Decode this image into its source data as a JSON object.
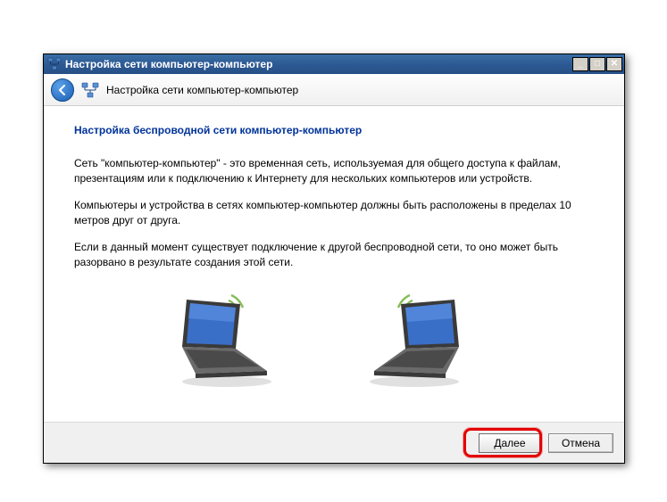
{
  "titlebar": {
    "title": "Настройка сети компьютер-компьютер"
  },
  "header": {
    "title": "Настройка сети компьютер-компьютер"
  },
  "content": {
    "heading": "Настройка беспроводной сети компьютер-компьютер",
    "para1": "Сеть \"компьютер-компьютер\" - это временная сеть, используемая для общего доступа к файлам, презентациям или к подключению к Интернету для нескольких компьютеров или устройств.",
    "para2": "Компьютеры и устройства в сетях компьютер-компьютер должны быть расположены в пределах 10 метров друг от друга.",
    "para3": "Если в данный момент существует подключение к другой беспроводной сети, то оно может быть разорвано в результате создания этой сети."
  },
  "footer": {
    "next_label": "Далее",
    "cancel_label": "Отмена"
  },
  "window_controls": {
    "minimize": "_",
    "maximize": "□",
    "close": "✕"
  }
}
